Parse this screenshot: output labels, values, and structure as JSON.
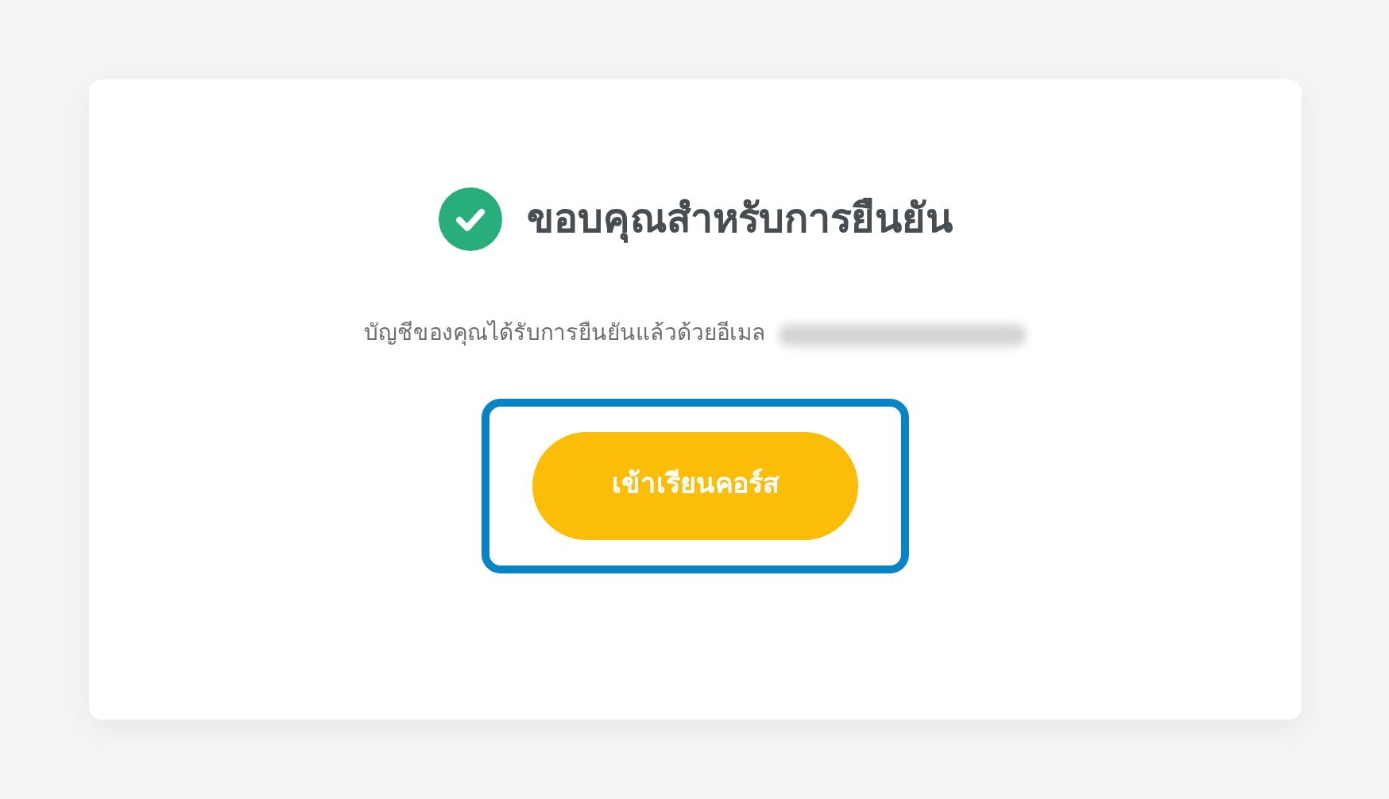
{
  "title": "ขอบคุณสำหรับการยืนยัน",
  "message": "บัญชีของคุณได้รับการยืนยันแล้วด้วยอีเมล",
  "email": {
    "kind": "redacted"
  },
  "button": {
    "label": "เข้าเรียนคอร์ส",
    "highlighted": true
  }
}
